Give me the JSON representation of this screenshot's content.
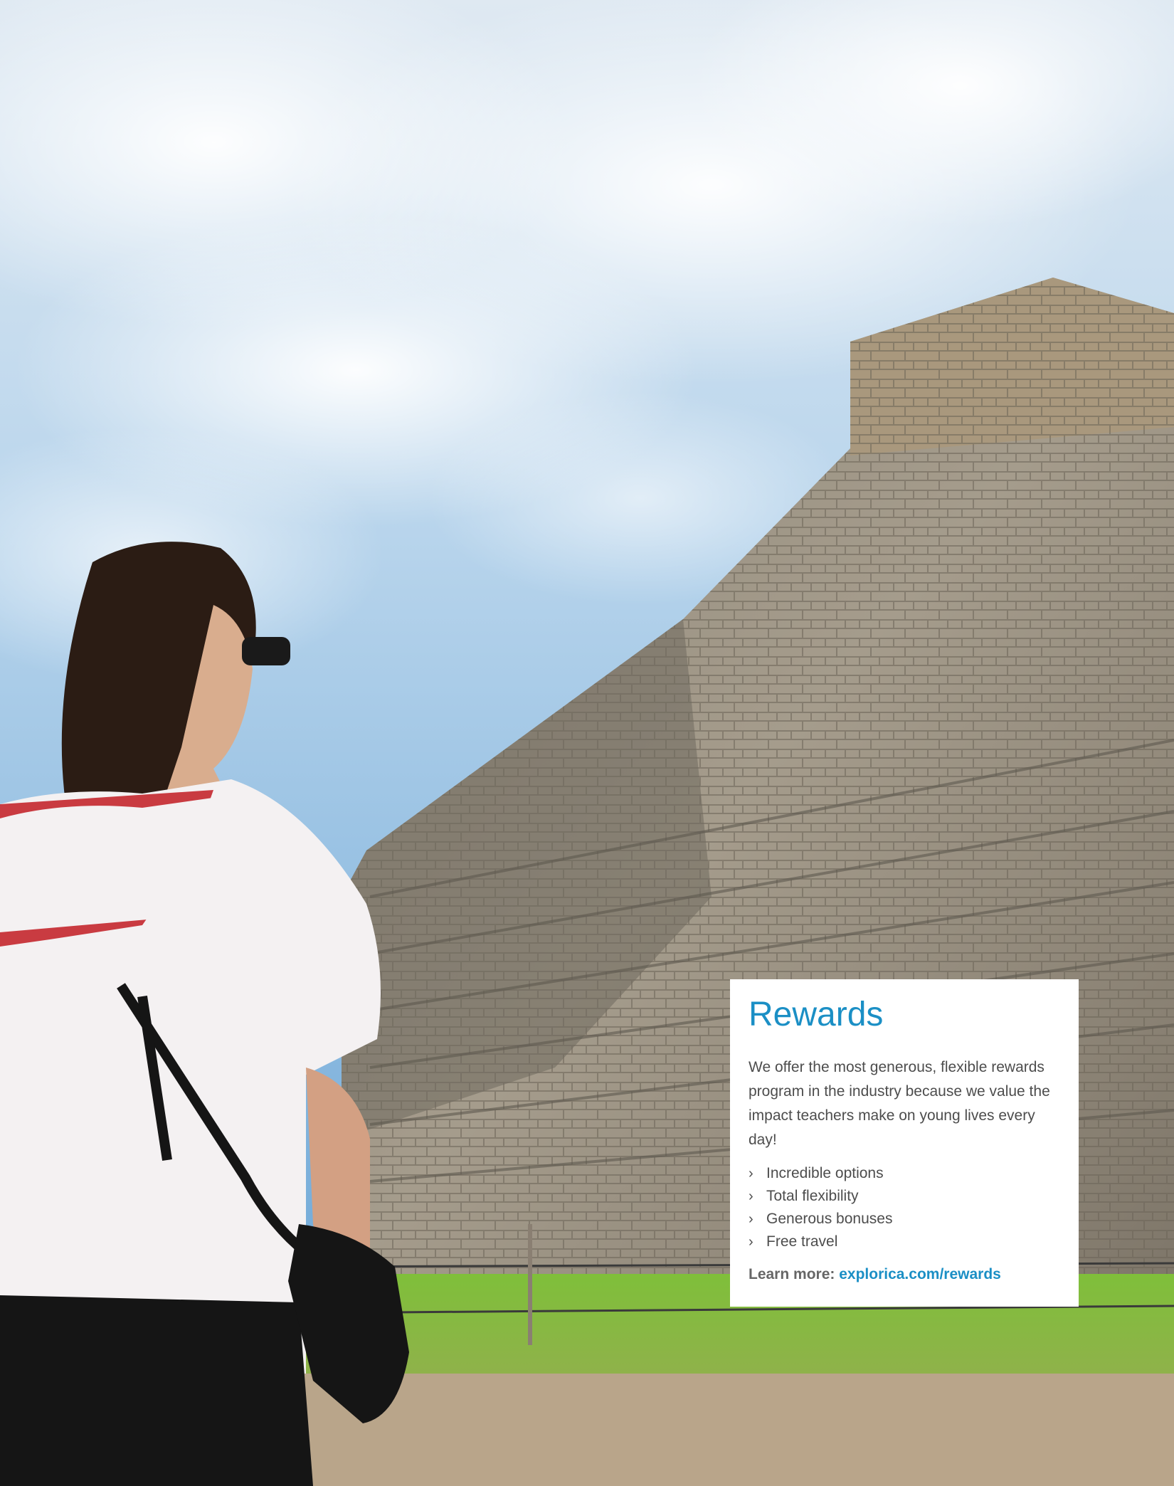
{
  "card": {
    "title": "Rewards",
    "body": "We offer the most generous, flexible rewards program in the industry because we value the impact teachers make on young lives every day!",
    "bullets": [
      "Incredible options",
      "Total flexibility",
      "Generous bonuses",
      "Free travel"
    ],
    "learn_label": "Learn more:",
    "learn_link": "explorica.com/rewards"
  },
  "colors": {
    "accent": "#1b8fc5",
    "body_text": "#4d4d4d"
  }
}
